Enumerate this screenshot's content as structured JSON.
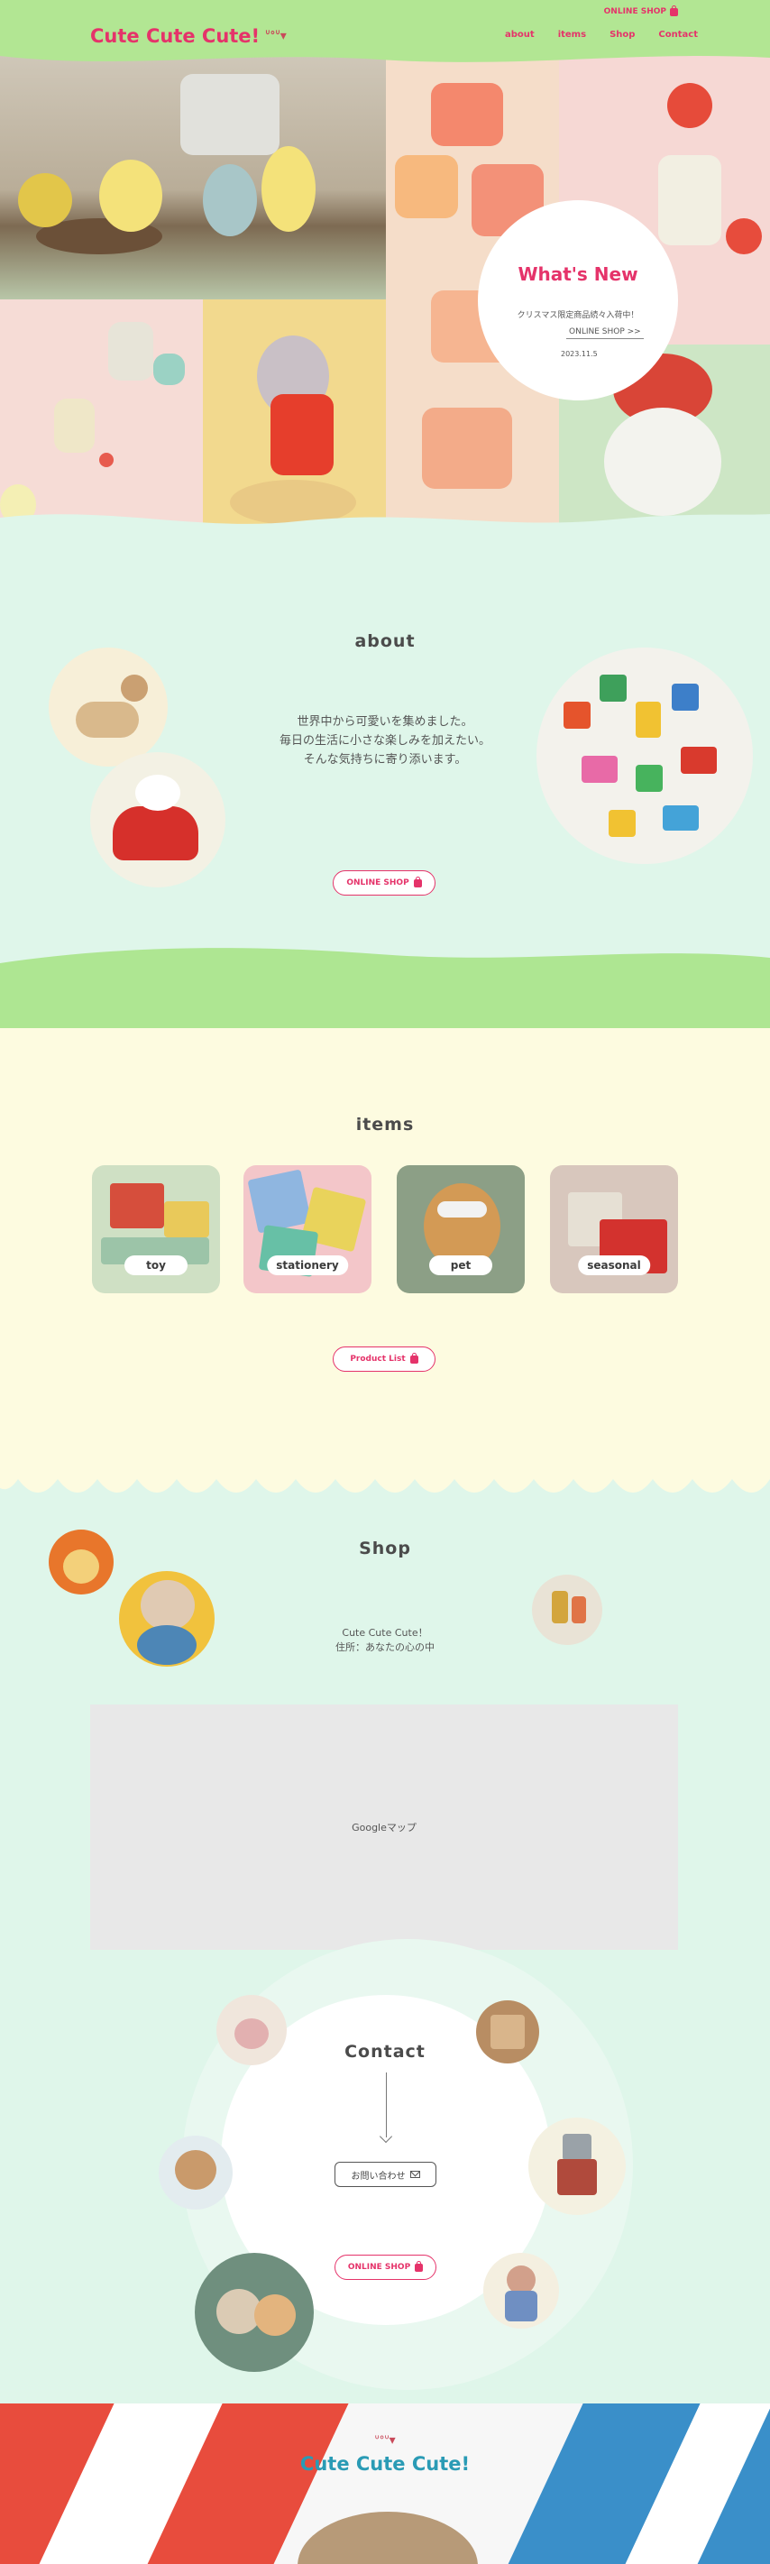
{
  "header": {
    "logo_text": "Cute Cute Cute!",
    "logo_icons": "ᐡᐤᐡ▾",
    "online_shop": "ONLINE SHOP",
    "nav": [
      "about",
      "items",
      "Shop",
      "Contact"
    ]
  },
  "whats_new": {
    "title": "What's New",
    "text": "クリスマス限定商品続々入荷中！",
    "link": "ONLINE SHOP >>",
    "date": "2023.11.5"
  },
  "about": {
    "title": "about",
    "lines": [
      "世界中から可愛いを集めました。",
      "毎日の生活に小さな楽しみを加えたい。",
      "そんな気持ちに寄り添います。"
    ],
    "button": "ONLINE SHOP"
  },
  "items": {
    "title": "items",
    "cards": [
      "toy",
      "stationery",
      "pet",
      "seasonal"
    ],
    "button": "Product List"
  },
  "shop": {
    "title": "Shop",
    "name": "Cute Cute Cute！",
    "address": "住所：あなたの心の中",
    "map_label": "Googleマップ"
  },
  "contact": {
    "title": "Contact",
    "button": "お問い合わせ",
    "shop_button": "ONLINE SHOP"
  },
  "footer": {
    "logo_text": "Cute Cute Cute!",
    "logo_icons": "ᐡᐤᐡ▾"
  },
  "colors": {
    "accent": "#e5336a",
    "header_green": "#b2e693",
    "mint": "#dff6ea",
    "cream": "#fdfbe0"
  }
}
